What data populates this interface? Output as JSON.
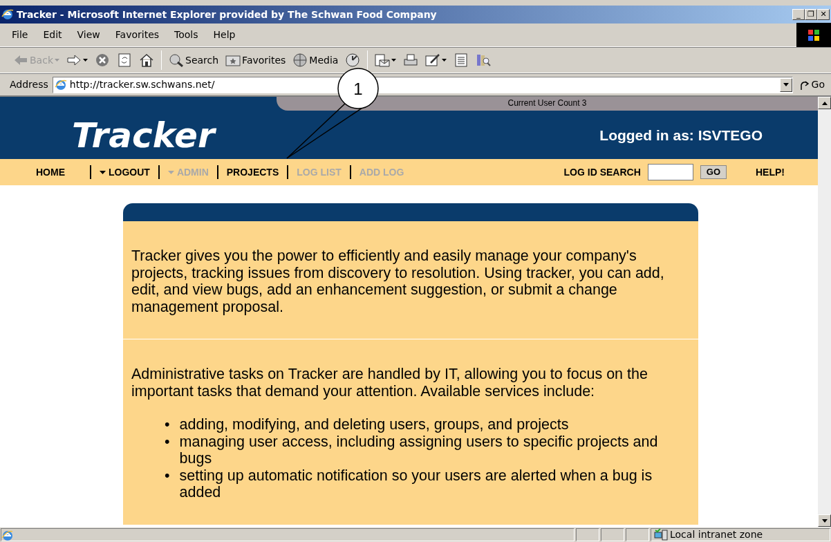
{
  "window": {
    "title": "Tracker - Microsoft Internet Explorer provided by The Schwan Food Company",
    "controls": [
      "_",
      "❐",
      "✕"
    ]
  },
  "menu": [
    "File",
    "Edit",
    "View",
    "Favorites",
    "Tools",
    "Help"
  ],
  "toolbar": [
    {
      "kind": "back",
      "label": "Back",
      "disabled": true
    },
    {
      "kind": "forward",
      "disabled": false
    },
    {
      "kind": "stop"
    },
    {
      "kind": "refresh"
    },
    {
      "kind": "home"
    },
    {
      "kind": "search",
      "label": "Search"
    },
    {
      "kind": "favorites",
      "label": "Favorites"
    },
    {
      "kind": "media",
      "label": "Media"
    },
    {
      "kind": "history"
    },
    {
      "kind": "mail"
    },
    {
      "kind": "print"
    },
    {
      "kind": "edit"
    },
    {
      "kind": "discuss"
    },
    {
      "kind": "research"
    }
  ],
  "address": {
    "label": "Address",
    "url": "http://tracker.sw.schwans.net/",
    "go": "Go"
  },
  "page": {
    "user_count": "Current User Count 3",
    "logo": "Tracker",
    "logged_in": "Logged in as: ISVTEGO",
    "nav": [
      {
        "label": "HOME",
        "dropdown": false,
        "disabled": false
      },
      {
        "label": "LOGOUT",
        "dropdown": true,
        "disabled": false
      },
      {
        "label": "ADMIN",
        "dropdown": true,
        "disabled": true
      },
      {
        "label": "PROJECTS",
        "dropdown": false,
        "disabled": false
      },
      {
        "label": "LOG LIST",
        "dropdown": false,
        "disabled": true
      },
      {
        "label": "ADD LOG",
        "dropdown": false,
        "disabled": true
      }
    ],
    "search_label": "LOG ID SEARCH",
    "search_button": "GO",
    "help": "HELP!",
    "intro": "Tracker gives you the power to efficiently and easily manage your company's projects, tracking issues from discovery to resolution. Using tracker, you can add, edit, and view bugs, add an enhancement suggestion, or submit a change management proposal.",
    "admin_text": "Administrative tasks on Tracker are handled by IT, allowing you to focus on the important tasks that demand your attention. Available services include:",
    "services": [
      {
        "bullet": "•",
        "text": "adding, modifying, and deleting users, groups, and projects"
      },
      {
        "bullet": "•",
        "text": "managing user access, including assigning users to specific projects and bugs"
      },
      {
        "bullet": "•",
        "text": "setting up automatic notification so your users are alerted when a bug is added"
      }
    ]
  },
  "status_bar": {
    "zone": "Local intranet zone"
  },
  "callout": {
    "number": "1"
  }
}
